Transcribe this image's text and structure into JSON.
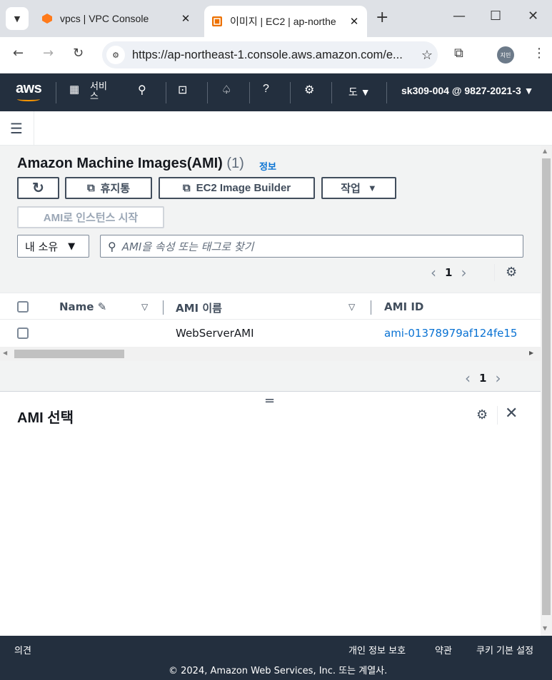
{
  "browser": {
    "tabs": [
      {
        "title": "vpcs | VPC Console",
        "active": false
      },
      {
        "title": "이미지 | EC2 | ap-northe",
        "active": true
      }
    ],
    "new_tab": "+",
    "close_glyph": "✕",
    "url": "https://ap-northeast-1.console.aws.amazon.com/e...",
    "profile_label": "지민"
  },
  "aws_nav": {
    "logo": "aws",
    "services_label": "서비스",
    "region_label": "도",
    "account_label": "sk309-004 @ 9827-2021-3"
  },
  "ami_list": {
    "title": "Amazon Machine Images(AMI)",
    "count": "(1)",
    "info_link": "정보",
    "buttons": {
      "refresh": "C",
      "recycle_bin": "휴지통",
      "image_builder": "EC2 Image Builder",
      "actions": "작업",
      "launch_instance": "AMI로 인스턴스 시작"
    },
    "owner_filter": "내 소유",
    "search_placeholder": "AMI을 속성 또는 태그로 찾기",
    "current_page": "1",
    "columns": [
      "Name",
      "AMI 이름",
      "AMI ID"
    ],
    "rows": [
      {
        "name": "",
        "ami_name": "WebServerAMI",
        "ami_id": "ami-01378979af124fe15"
      }
    ]
  },
  "bottom_pager": {
    "current_page": "1"
  },
  "detail_panel": {
    "title": "AMI 선택",
    "handle": "="
  },
  "footer": {
    "feedback": "의견",
    "privacy": "개인 정보 보호",
    "terms": "약관",
    "cookies": "쿠키 기본 설정",
    "copyright": "© 2024, Amazon Web Services, Inc. 또는 계열사."
  },
  "colors": {
    "aws_nav_bg": "#232f3e",
    "link_blue": "#0972d3",
    "aws_orange": "#ff9900"
  }
}
